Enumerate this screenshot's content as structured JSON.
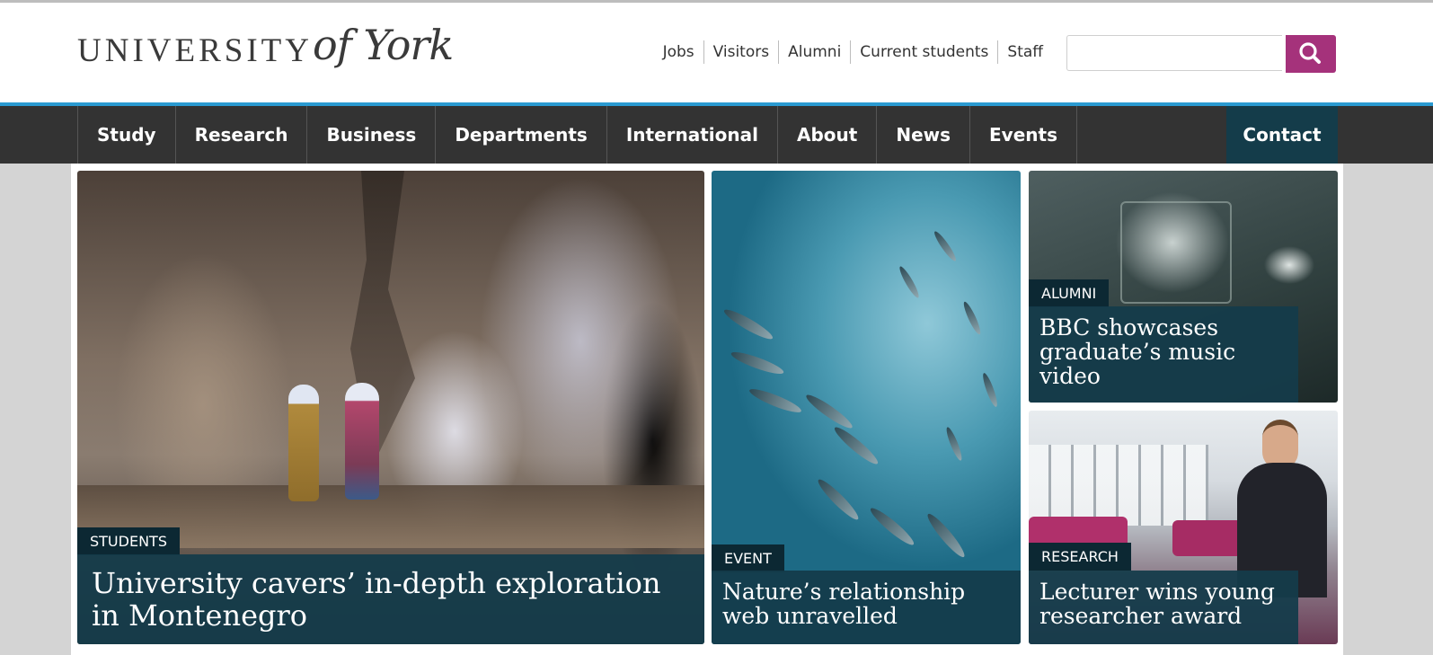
{
  "header": {
    "logo_main": "UNIVERSITY",
    "logo_script": "of York",
    "util_links": [
      "Jobs",
      "Visitors",
      "Alumni",
      "Current students",
      "Staff"
    ],
    "search_placeholder": ""
  },
  "nav": {
    "items": [
      "Study",
      "Research",
      "Business",
      "Departments",
      "International",
      "About",
      "News",
      "Events"
    ],
    "contact": "Contact"
  },
  "features": [
    {
      "tag": "STUDENTS",
      "headline": "University cavers’ in-depth exploration in Montenegro"
    },
    {
      "tag": "EVENT",
      "headline": "Nature’s relationship web unravelled"
    },
    {
      "tag": "ALUMNI",
      "headline": "BBC showcases graduate’s music video"
    },
    {
      "tag": "RESEARCH",
      "headline": "Lecturer wins young researcher award"
    }
  ],
  "colors": {
    "accent_search": "#a5327b",
    "accent_line": "#2a9ad1",
    "nav_bg": "#333333",
    "contact_bg": "#143c4a",
    "headline_bg": "#143b4a"
  },
  "icons": {
    "search": "search-icon"
  }
}
